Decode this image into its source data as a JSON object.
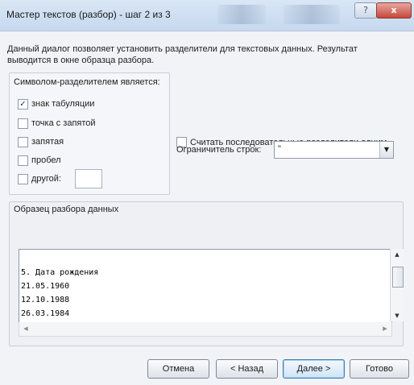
{
  "window": {
    "title": "Мастер текстов (разбор) - шаг 2 из 3",
    "help_label": "?",
    "close_label": "x"
  },
  "description": "Данный диалог позволяет установить разделители для текстовых данных. Результат выводится в окне образца разбора.",
  "delimiters": {
    "title": "Символом-разделителем является:",
    "items": [
      {
        "label": "знак табуляции",
        "checked": true,
        "mark": "✓"
      },
      {
        "label": "точка с запятой",
        "checked": false,
        "mark": ""
      },
      {
        "label": "запятая",
        "checked": false,
        "mark": ""
      },
      {
        "label": "пробел",
        "checked": false,
        "mark": ""
      },
      {
        "label": "другой:",
        "checked": false,
        "mark": ""
      }
    ],
    "other_value": ""
  },
  "consecutive": {
    "label": "Считать последовательные разделители одним",
    "checked": false
  },
  "qualifier": {
    "label": "Ограничитель строк:",
    "value": "\"",
    "arrow": "▼"
  },
  "preview": {
    "title": "Образец разбора данных",
    "lines": [
      "5. Дата рождения",
      "21.05.1960",
      "12.10.1988",
      "26.03.1984"
    ]
  },
  "scroll": {
    "up": "▲",
    "down": "▼",
    "left": "◀",
    "right": "▶"
  },
  "buttons": {
    "cancel": "Отмена",
    "back": "< Назад",
    "next": "Далее >",
    "finish": "Готово"
  }
}
